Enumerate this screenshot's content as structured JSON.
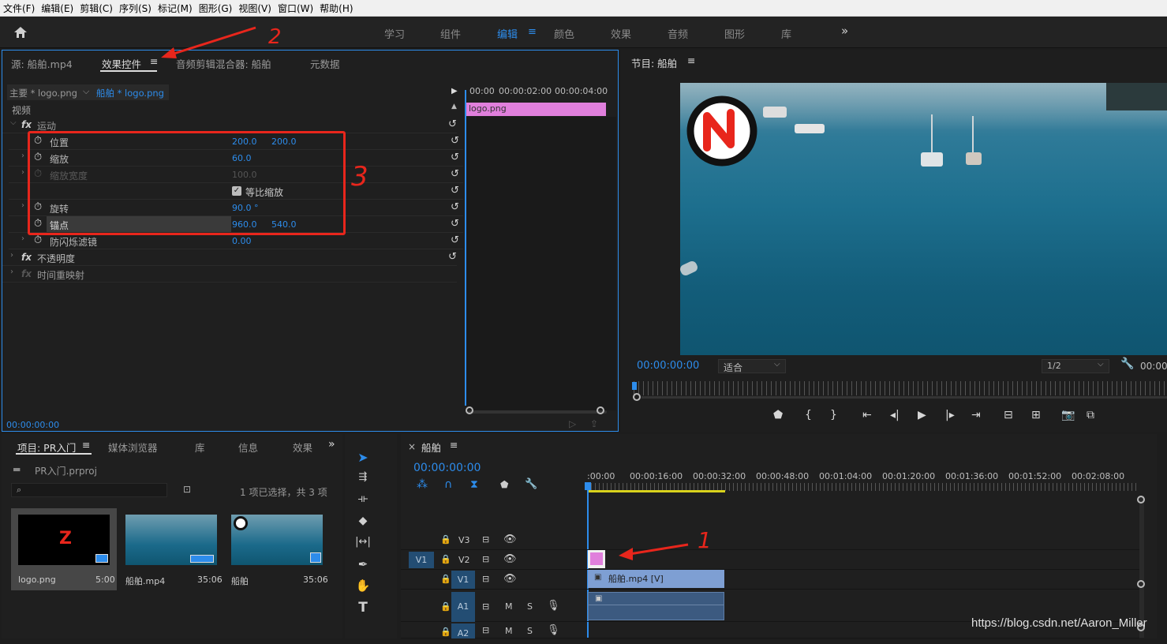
{
  "menubar": [
    "文件(F)",
    "编辑(E)",
    "剪辑(C)",
    "序列(S)",
    "标记(M)",
    "图形(G)",
    "视图(V)",
    "窗口(W)",
    "帮助(H)"
  ],
  "workspaces": [
    "学习",
    "组件",
    "编辑",
    "颜色",
    "效果",
    "音频",
    "图形",
    "库"
  ],
  "workspace_more": "»",
  "effect_panel": {
    "tabs": [
      "源: 船舶.mp4",
      "效果控件",
      "音频剪辑混合器: 船舶",
      "元数据"
    ],
    "menu_icon": "≡",
    "master": "主要 * logo.png",
    "clip": "船舶 * logo.png",
    "section_video": "视频",
    "timecodes": [
      "00:00",
      "00:00:02:00",
      "00:00:04:00"
    ],
    "clip_bar": "logo.png",
    "groups": {
      "motion": "运动",
      "opacity": "不透明度",
      "remap": "时间重映射"
    },
    "props": {
      "position": {
        "label": "位置",
        "v1": "200.0",
        "v2": "200.0"
      },
      "scale": {
        "label": "缩放",
        "v1": "60.0"
      },
      "scale_width": {
        "label": "缩放宽度",
        "v1": "100.0"
      },
      "uniform": {
        "label": "等比缩放"
      },
      "rotation": {
        "label": "旋转",
        "v1": "90.0 °"
      },
      "anchor": {
        "label": "锚点",
        "v1": "960.0",
        "v2": "540.0"
      },
      "flicker": {
        "label": "防闪烁滤镜",
        "v1": "0.00"
      }
    },
    "bottom_time": "00:00:00:00"
  },
  "program": {
    "title": "节目: 船舶",
    "time": "00:00:00:00",
    "fit": "适合",
    "res": "1/2",
    "time_right": "00:00"
  },
  "project": {
    "tabs": [
      "项目: PR入门",
      "媒体浏览器",
      "库",
      "信息",
      "效果"
    ],
    "file": "PR入门.prproj",
    "status": "1 项已选择，共 3 项",
    "items": [
      {
        "name": "logo.png",
        "dur": "5:00"
      },
      {
        "name": "船舶.mp4",
        "dur": "35:06"
      },
      {
        "name": "船舶",
        "dur": "35:06"
      }
    ]
  },
  "timeline": {
    "title": "船舶",
    "time": "00:00:00:00",
    "ruler": [
      ":00:00",
      "00:00:16:00",
      "00:00:32:00",
      "00:00:48:00",
      "00:01:04:00",
      "00:01:20:00",
      "00:01:36:00",
      "00:01:52:00",
      "00:02:08:00"
    ],
    "tracks": {
      "v3": "V3",
      "v2": "V2",
      "v1": "V1",
      "a1": "A1",
      "a2": "A2",
      "src_v1": "V1"
    },
    "m": "M",
    "s": "S",
    "clip_v1": "船舶.mp4 [V]"
  },
  "annotations": {
    "one": "1",
    "two": "2",
    "three": "3"
  },
  "watermark": "https://blog.csdn.net/Aaron_Miller",
  "colors": {
    "accent": "#2d8ceb",
    "annotation": "#e8261c",
    "clip_pink": "#e07fdc",
    "clip_blue": "#6f90c4"
  }
}
